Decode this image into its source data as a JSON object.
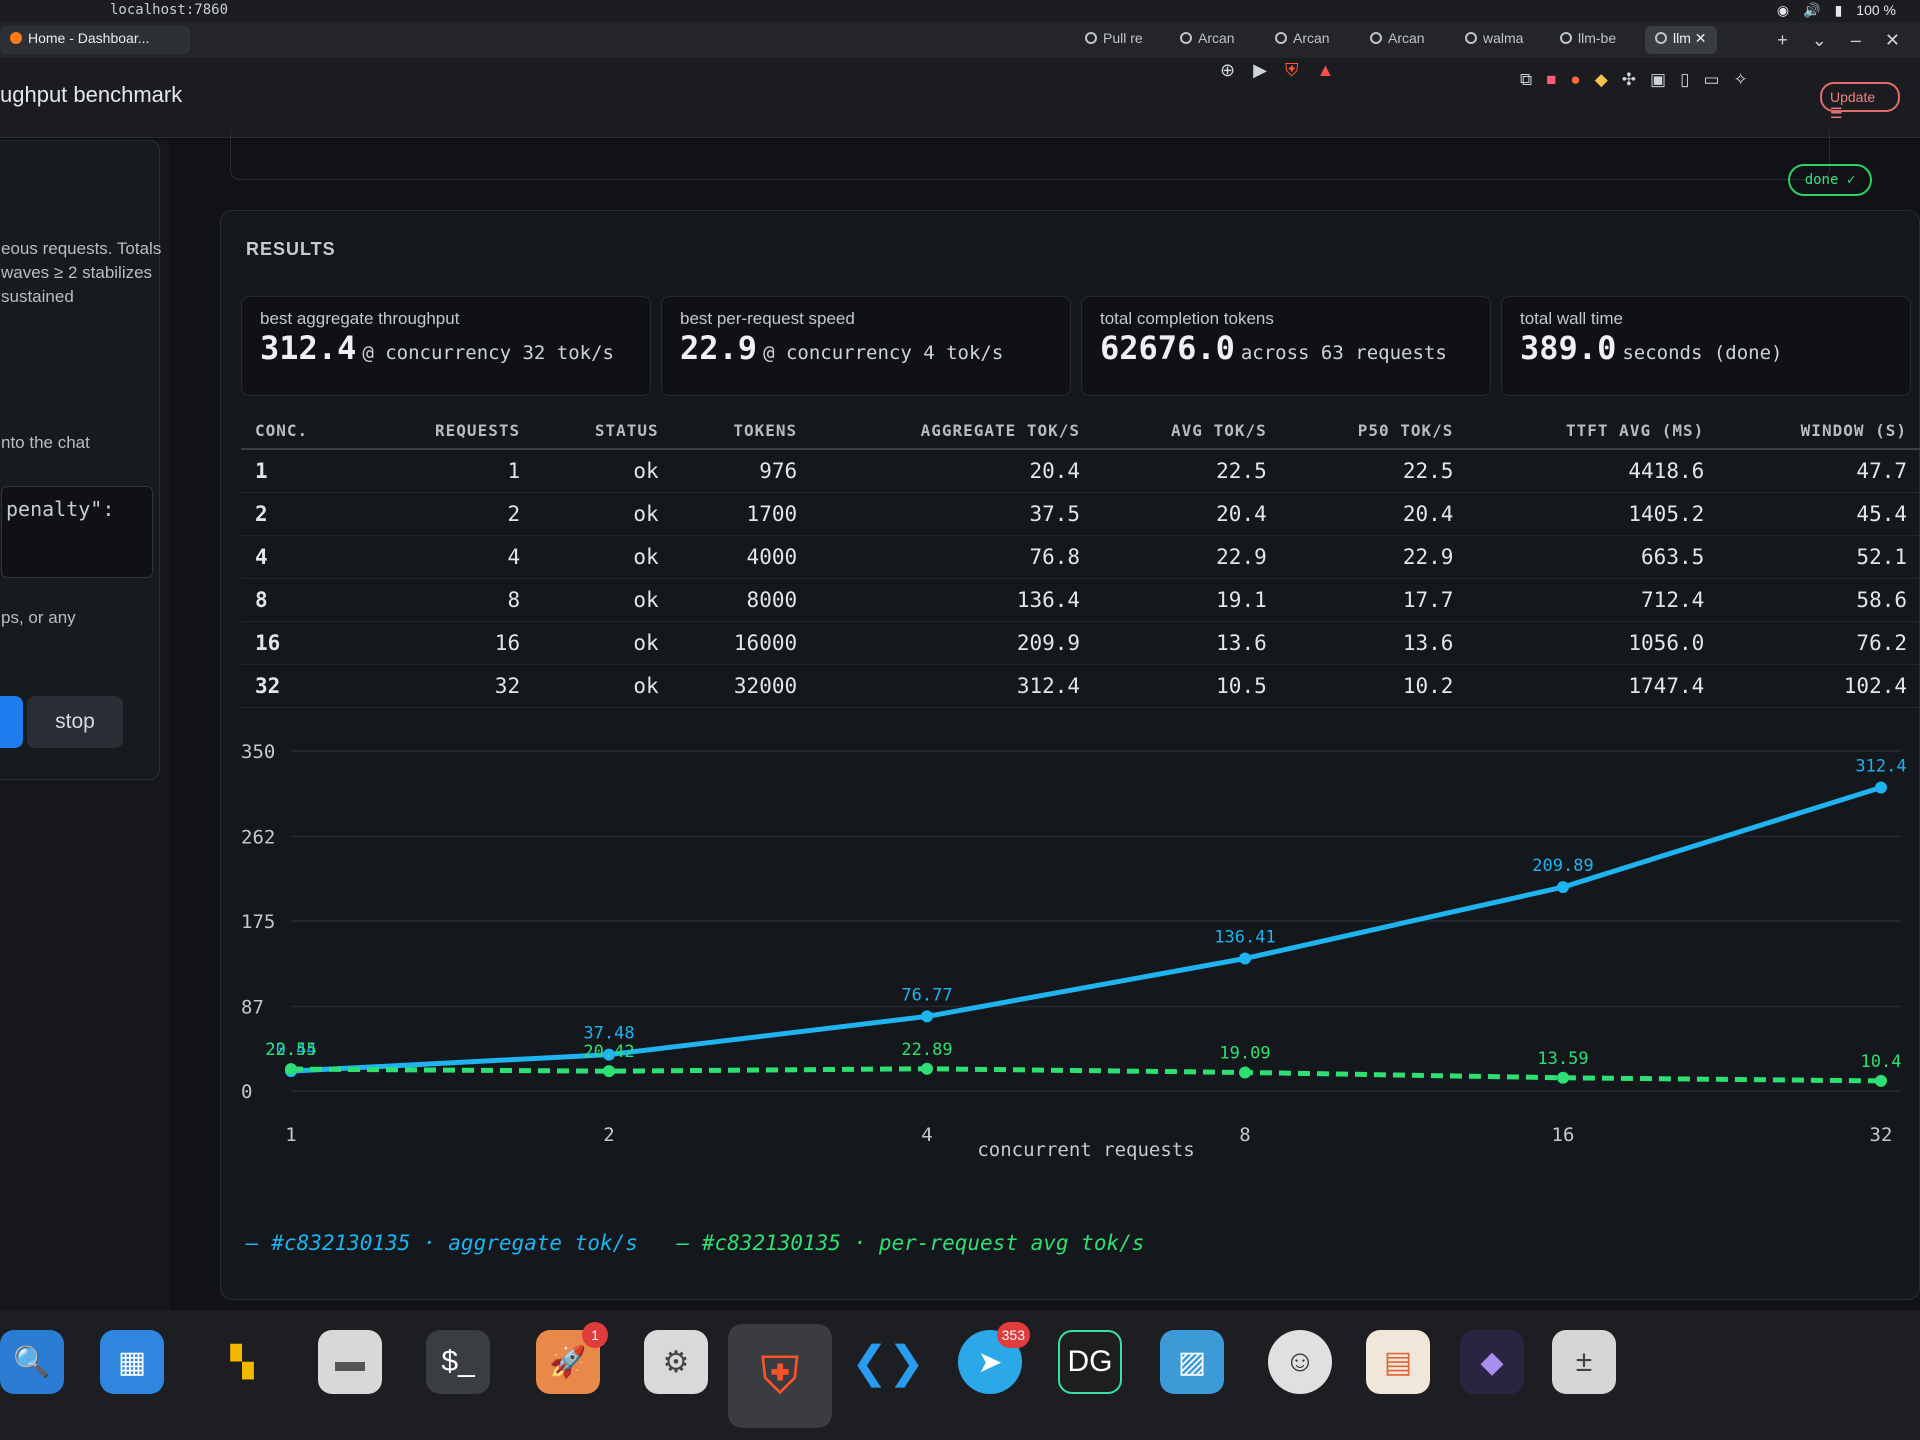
{
  "os": {
    "address": "localhost:7860",
    "battery": "100 %"
  },
  "browser": {
    "tabs": [
      "Home - Dashboar...",
      "Pull re",
      "Arcan",
      "Arcan",
      "Arcan",
      "walma",
      "llm-be",
      "llm"
    ],
    "update_label": "Update"
  },
  "page": {
    "title": "ughput benchmark"
  },
  "sidebar": {
    "text1": [
      "eous requests. Totals",
      "waves ≥ 2 stabilizes",
      "sustained"
    ],
    "text2": "nto the chat",
    "code": "penalty\":",
    "text3": "ps, or any",
    "stop_label": "stop"
  },
  "status_badge": "done ✓",
  "results": {
    "heading": "RESULTS",
    "stats": [
      {
        "label": "best aggregate throughput",
        "value": "312.4",
        "unit": "@ concurrency 32 tok/s"
      },
      {
        "label": "best per-request speed",
        "value": "22.9",
        "unit": "@ concurrency 4 tok/s"
      },
      {
        "label": "total completion tokens",
        "value": "62676.0",
        "unit": "across 63 requests"
      },
      {
        "label": "total wall time",
        "value": "389.0",
        "unit": "seconds (done)"
      }
    ],
    "table": {
      "headers": [
        "CONC.",
        "REQUESTS",
        "STATUS",
        "TOKENS",
        "AGGREGATE TOK/S",
        "AVG TOK/S",
        "P50 TOK/S",
        "TTFT AVG (MS)",
        "WINDOW (S)"
      ],
      "rows": [
        [
          "1",
          "1",
          "ok",
          "976",
          "20.4",
          "22.5",
          "22.5",
          "4418.6",
          "47.7"
        ],
        [
          "2",
          "2",
          "ok",
          "1700",
          "37.5",
          "20.4",
          "20.4",
          "1405.2",
          "45.4"
        ],
        [
          "4",
          "4",
          "ok",
          "4000",
          "76.8",
          "22.9",
          "22.9",
          "663.5",
          "52.1"
        ],
        [
          "8",
          "8",
          "ok",
          "8000",
          "136.4",
          "19.1",
          "17.7",
          "712.4",
          "58.6"
        ],
        [
          "16",
          "16",
          "ok",
          "16000",
          "209.9",
          "13.6",
          "13.6",
          "1056.0",
          "76.2"
        ],
        [
          "32",
          "32",
          "ok",
          "32000",
          "312.4",
          "10.5",
          "10.2",
          "1747.4",
          "102.4"
        ]
      ]
    }
  },
  "chart_data": {
    "type": "line",
    "categories": [
      "1",
      "2",
      "4",
      "8",
      "16",
      "32"
    ],
    "xlabel": "concurrent requests",
    "ylim": [
      0,
      350
    ],
    "yticks": [
      "0",
      "87",
      "175",
      "262",
      "350"
    ],
    "series": [
      {
        "name": "#c832130135 · aggregate tok/s",
        "color": "#1fb3f0",
        "values": [
          20.44,
          37.48,
          76.77,
          136.41,
          209.89,
          312.4
        ],
        "labels": [
          "20.44",
          "37.48",
          "76.77",
          "136.41",
          "209.89",
          "312.4"
        ]
      },
      {
        "name": "#c832130135 · per-request avg tok/s",
        "color": "#2ee073",
        "values": [
          22.55,
          20.42,
          22.89,
          19.09,
          13.59,
          10.4
        ],
        "labels": [
          "22.55",
          "20.42",
          "22.89",
          "19.09",
          "13.59",
          "10.4"
        ]
      }
    ]
  },
  "legend": {
    "a": "— #c832130135 · aggregate tok/s",
    "b": "— #c832130135 · per-request avg tok/s"
  },
  "dock": {
    "badge_launcher": "1",
    "badge_telegram": "353"
  }
}
